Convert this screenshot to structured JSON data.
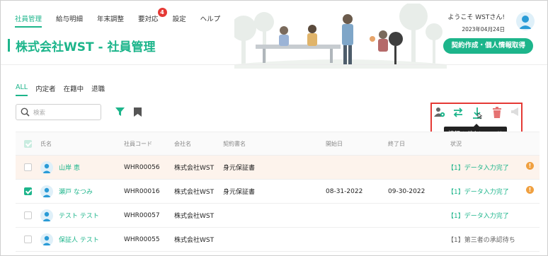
{
  "nav": {
    "items": [
      {
        "label": "社員管理",
        "active": true
      },
      {
        "label": "給与明細",
        "active": false
      },
      {
        "label": "年末調整",
        "active": false
      },
      {
        "label": "要対応",
        "active": false,
        "badge": "4"
      },
      {
        "label": "設定",
        "active": false
      },
      {
        "label": "ヘルプ",
        "active": false
      }
    ]
  },
  "user": {
    "welcome": "ようこそ WSTさん!",
    "date": "2023年04月24日"
  },
  "cta_label": "契約作成・個人情報取得",
  "page_title": "株式会社WST - 社員管理",
  "filter_tabs": [
    "ALL",
    "内定者",
    "在籍中",
    "退職"
  ],
  "search": {
    "placeholder": "検索"
  },
  "toolbar": {
    "icons": [
      "person-settings-icon",
      "swap-icon",
      "download-icon",
      "trash-icon",
      "megaphone-icon"
    ],
    "tooltip": "情報のダウンロード"
  },
  "table": {
    "headers": [
      "氏名",
      "社員コード",
      "会社名",
      "契約書名",
      "開始日",
      "終了日",
      "状況"
    ],
    "rows": [
      {
        "name": "山岸 恵",
        "code": "WHR00056",
        "company": "株式会社WST",
        "contract": "身元保証書",
        "start": "",
        "end": "",
        "status": "【1】データ入力完了",
        "checked": false,
        "highlight": true,
        "warn": true
      },
      {
        "name": "瀬戸 なつみ",
        "code": "WHR00016",
        "company": "株式会社WST",
        "contract": "身元保証書",
        "start": "08-31-2022",
        "end": "09-30-2022",
        "status": "【1】データ入力完了",
        "checked": true,
        "highlight": false,
        "warn": true
      },
      {
        "name": "テスト テスト",
        "code": "WHR00057",
        "company": "株式会社WST",
        "contract": "",
        "start": "",
        "end": "",
        "status": "【1】データ入力完了",
        "checked": false,
        "highlight": false,
        "warn": false
      },
      {
        "name": "保証人 テスト",
        "code": "WHR00055",
        "company": "株式会社WST",
        "contract": "",
        "start": "",
        "end": "",
        "status": "【1】第三者の承認待ち",
        "checked": false,
        "highlight": false,
        "warn": false,
        "status_gray": true
      }
    ]
  },
  "colors": {
    "accent": "#1db58b",
    "alert": "#e53935",
    "highlight_row": "#fdf3ec",
    "warn": "#f0a040"
  }
}
